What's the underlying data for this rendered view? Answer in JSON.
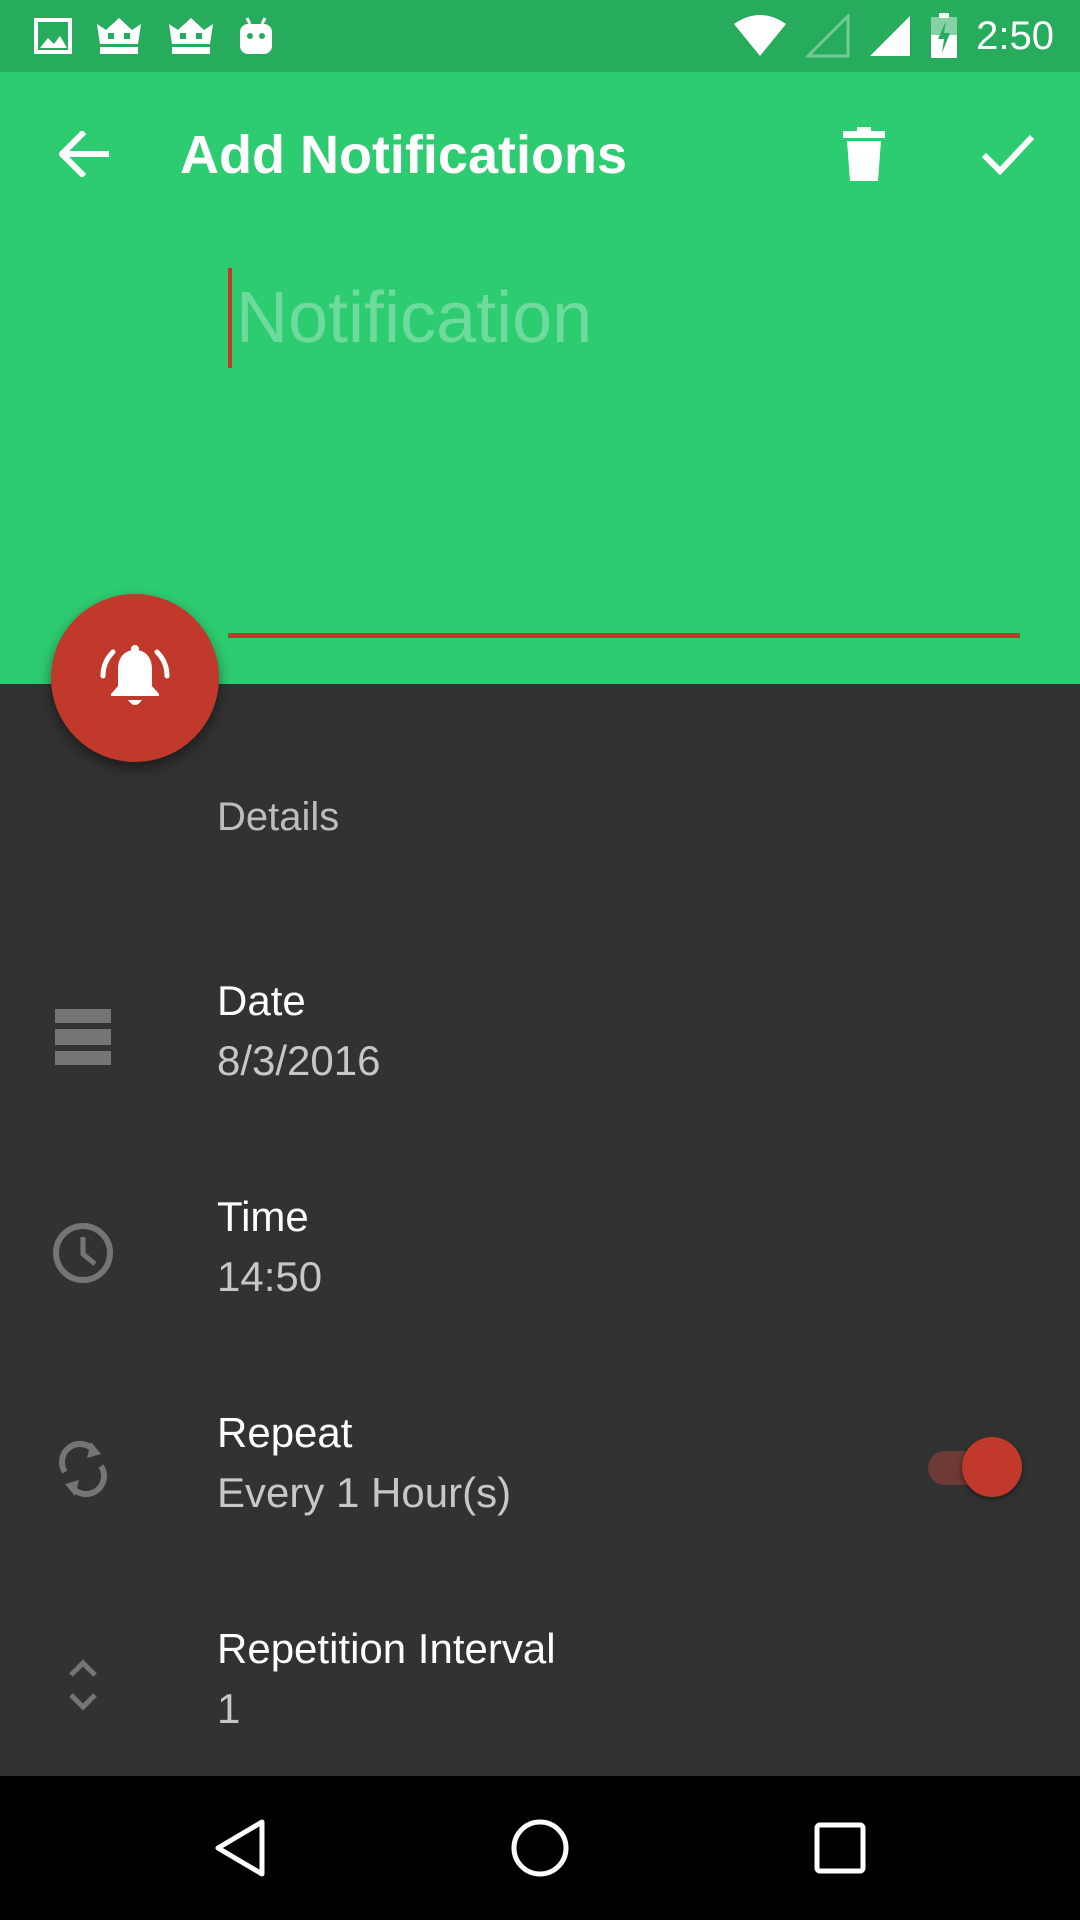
{
  "status_bar": {
    "time": "2:50",
    "left_icons": [
      "image-icon",
      "crown-icon",
      "crown-icon",
      "android-icon"
    ],
    "right_icons": [
      "wifi-icon",
      "signal-empty-icon",
      "signal-full-icon",
      "battery-charging-icon"
    ]
  },
  "toolbar": {
    "title": "Add Notifications",
    "back_icon": "arrow-back-icon",
    "delete_icon": "delete-icon",
    "confirm_icon": "check-icon"
  },
  "notification_input": {
    "value": "",
    "placeholder": "Notification"
  },
  "fab": {
    "icon": "bell-ringing-icon"
  },
  "details": {
    "header": "Details",
    "date": {
      "label": "Date",
      "value": "8/3/2016",
      "icon": "calendar-view-icon"
    },
    "time": {
      "label": "Time",
      "value": "14:50",
      "icon": "clock-icon"
    },
    "repeat": {
      "label": "Repeat",
      "value": "Every 1 Hour(s)",
      "icon": "repeat-icon",
      "enabled": true
    },
    "interval": {
      "label": "Repetition Interval",
      "value": "1",
      "icon": "unfold-icon"
    }
  },
  "colors": {
    "primary": "#2ECC71",
    "primary_dark": "#27AC5E",
    "accent": "#C0392B",
    "background": "#323232"
  },
  "nav_bar": {
    "back_icon": "nav-back-icon",
    "home_icon": "nav-home-icon",
    "recents_icon": "nav-recents-icon"
  }
}
